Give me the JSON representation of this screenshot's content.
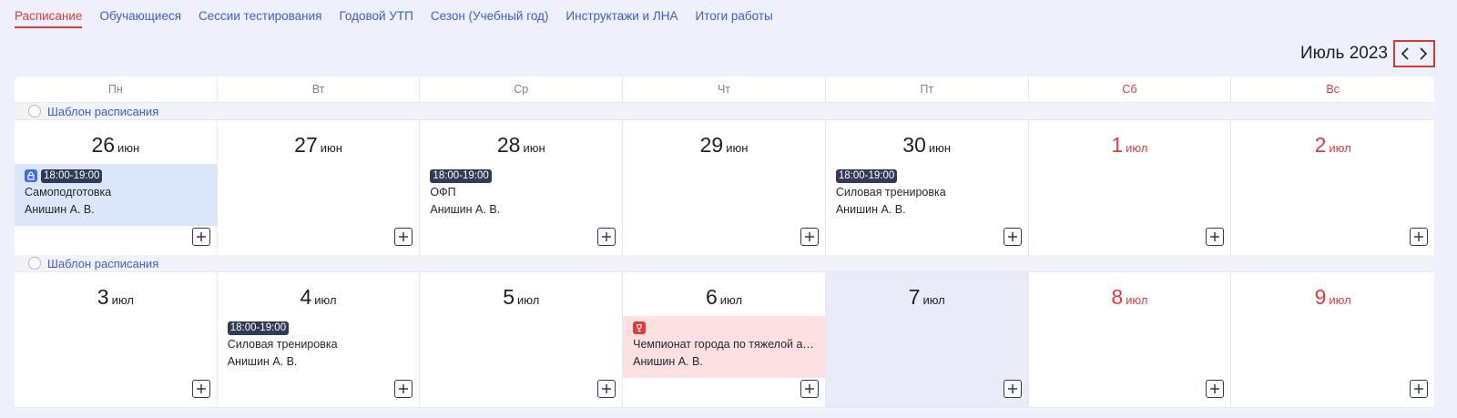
{
  "tabs": [
    {
      "label": "Расписание",
      "active": true
    },
    {
      "label": "Обучающиеся"
    },
    {
      "label": "Сессии тестирования"
    },
    {
      "label": "Годовой УТП"
    },
    {
      "label": "Сезон (Учебный год)"
    },
    {
      "label": "Инструктажи и ЛНА"
    },
    {
      "label": "Итоги работы"
    }
  ],
  "calendar": {
    "month_title": "Июль 2023",
    "weekdays": [
      "Пн",
      "Вт",
      "Ср",
      "Чт",
      "Пт",
      "Сб",
      "Вс"
    ],
    "template_label": "Шаблон расписания",
    "weeks": [
      {
        "days": [
          {
            "num": "26",
            "mon": "июн"
          },
          {
            "num": "27",
            "mon": "июн"
          },
          {
            "num": "28",
            "mon": "июн"
          },
          {
            "num": "29",
            "mon": "июн"
          },
          {
            "num": "30",
            "mon": "июн"
          },
          {
            "num": "1",
            "mon": "июл"
          },
          {
            "num": "2",
            "mon": "июл"
          }
        ]
      },
      {
        "days": [
          {
            "num": "3",
            "mon": "июл"
          },
          {
            "num": "4",
            "mon": "июл"
          },
          {
            "num": "5",
            "mon": "июл"
          },
          {
            "num": "6",
            "mon": "июл"
          },
          {
            "num": "7",
            "mon": "июл"
          },
          {
            "num": "8",
            "mon": "июл"
          },
          {
            "num": "9",
            "mon": "июл"
          }
        ]
      }
    ],
    "events": {
      "w1_mon": {
        "time": "18:00-19:00",
        "title": "Самоподготовка",
        "person": "Анишин А. В."
      },
      "w1_wed": {
        "time": "18:00-19:00",
        "title": "ОФП",
        "person": "Анишин А. В."
      },
      "w1_fri": {
        "time": "18:00-19:00",
        "title": "Силовая тренировка",
        "person": "Анишин А. В."
      },
      "w2_tue": {
        "time": "18:00-19:00",
        "title": "Силовая тренировка",
        "person": "Анишин А. В."
      },
      "w2_thu": {
        "title": "Чемпионат города по тяжелой атлетике",
        "person": "Анишин А. В."
      }
    }
  },
  "colors": {
    "accent_red": "#e23b3b",
    "link_blue": "#3d5bd9",
    "time_badge": "#2f3b57",
    "event_blue_bg": "#dbe6fb",
    "event_pink_bg": "#fde0e0",
    "today_bg": "#e9ecf8"
  },
  "icons": {
    "prev": "chevron-left-icon",
    "next": "chevron-right-icon",
    "add": "plus-icon",
    "lock": "lock-icon",
    "trophy": "trophy-icon"
  }
}
